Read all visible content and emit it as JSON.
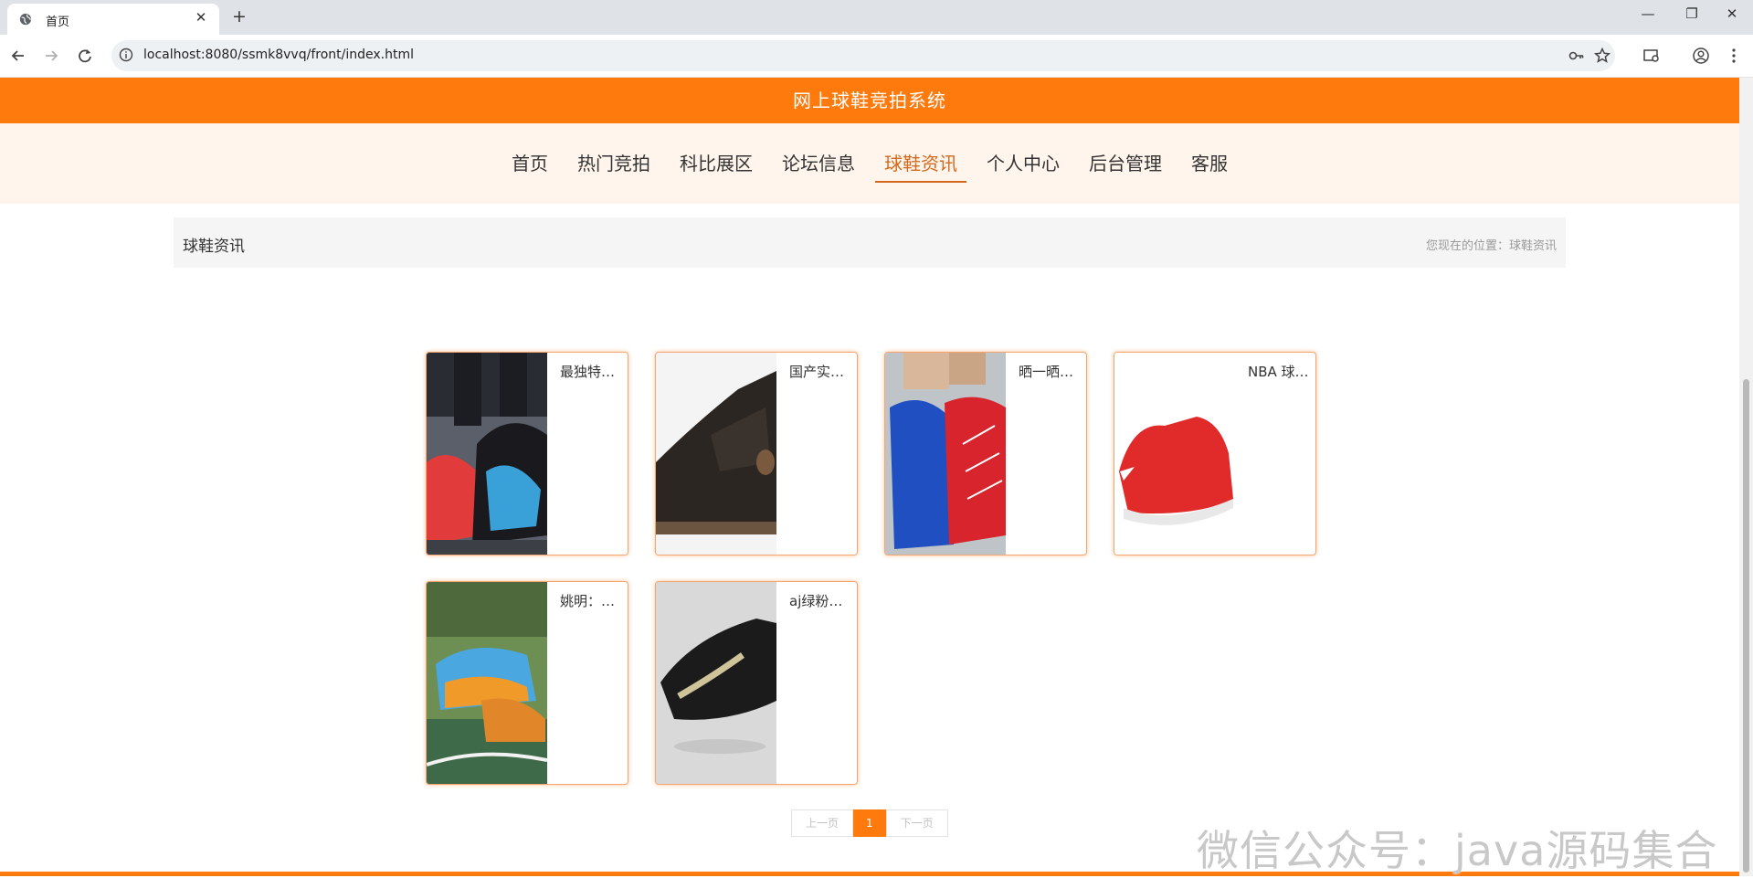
{
  "browser": {
    "tab_title": "首页",
    "tab_close": "✕",
    "new_tab": "+",
    "url": "localhost:8080/ssmk8vvq/front/index.html",
    "window_controls": [
      "—",
      "❐",
      "✕"
    ]
  },
  "site": {
    "title": "网上球鞋竞拍系统"
  },
  "nav": {
    "items": [
      "首页",
      "热门竞拍",
      "科比展区",
      "论坛信息",
      "球鞋资讯",
      "个人中心",
      "后台管理",
      "客服"
    ],
    "active": "球鞋资讯"
  },
  "breadcrumb": {
    "section": "球鞋资讯",
    "location": "您现在的位置：球鞋资讯"
  },
  "news": [
    {
      "title": "最独特的球鞋",
      "image": "red-blue-sneakers-photo"
    },
    {
      "title": "国产实战球鞋",
      "image": "black-leather-sneaker-photo"
    },
    {
      "title": "晒一晒我的球鞋",
      "image": "blue-red-sneakers-in-hand-photo"
    },
    {
      "title": "NBA 球星球鞋",
      "image": "red-high-top-sneaker-photo"
    },
    {
      "title": "姚明：球鞋",
      "image": "blue-orange-sneaker-on-court-photo"
    },
    {
      "title": "aj绿粉超级好看",
      "image": "black-gold-sneaker-photo"
    }
  ],
  "pagination": {
    "prev": "上一页",
    "current": "1",
    "next": "下一页"
  },
  "watermark": "微信公众号：java源码集合",
  "colors": {
    "accent": "#ff7a0c",
    "nav_bg": "#fff5ec",
    "active_nav": "#d2691e"
  }
}
